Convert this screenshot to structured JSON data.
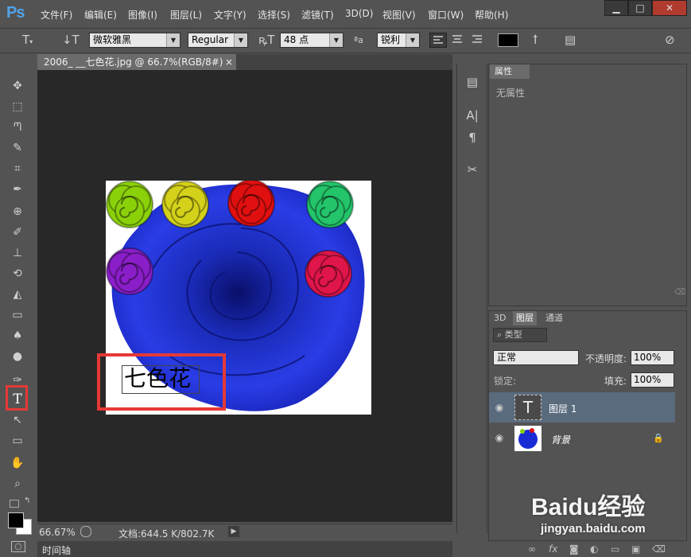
{
  "app": {
    "logo": "Ps"
  },
  "menu": [
    "文件(F)",
    "编辑(E)",
    "图像(I)",
    "图层(L)",
    "文字(Y)",
    "选择(S)",
    "滤镜(T)",
    "3D(D)",
    "视图(V)",
    "窗口(W)",
    "帮助(H)"
  ],
  "window_controls": {
    "minimize": "▁",
    "maximize": "□",
    "close": "✕"
  },
  "options": {
    "font_family": "微软雅黑",
    "font_style": "Regular",
    "font_size": "48 点",
    "aa_label": "ªa",
    "anti_alias": "锐利",
    "text_color": "#000000"
  },
  "document": {
    "tab_title": "2006_ __七色花.jpg @ 66.7%(RGB/8#)",
    "tab_close": "×",
    "text_layer_content": "七色花"
  },
  "status": {
    "zoom": "66.67%",
    "doc_info": "文档:644.5 K/802.7K"
  },
  "timeline": {
    "label": "时间轴"
  },
  "properties": {
    "tab": "属性",
    "content": "无属性"
  },
  "layers_panel": {
    "tabs": [
      "3D",
      "图层",
      "通道"
    ],
    "filter_label": "类型",
    "blend_mode": "正常",
    "opacity_label": "不透明度:",
    "opacity_value": "100%",
    "lock_label": "锁定:",
    "fill_label": "填充:",
    "fill_value": "100%",
    "layers": [
      {
        "name": "图层 1",
        "selected": true
      },
      {
        "name": "背景",
        "selected": false
      }
    ]
  },
  "watermark": {
    "brand": "Baidu经验",
    "url": "jingyan.baidu.com"
  },
  "colors": {
    "highlight_box": "#e53935",
    "rose_blue": "#1a2bd6",
    "accent_selected": "#5a6b7e"
  },
  "flowers": [
    {
      "color": "#8bd10a"
    },
    {
      "color": "#d4d11a"
    },
    {
      "color": "#e01010"
    },
    {
      "color": "#23c46a"
    },
    {
      "color": "#8a1ec8"
    },
    {
      "color": "#e0154a"
    }
  ]
}
